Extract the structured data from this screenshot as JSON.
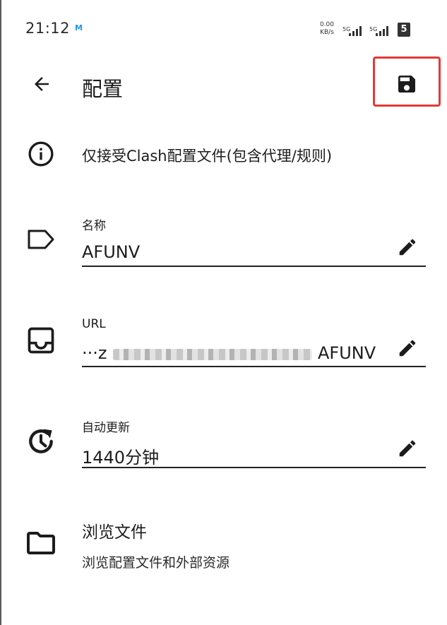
{
  "status_bar": {
    "time": "21:12",
    "carrier_logo": "M",
    "net_speed_value": "0.00",
    "net_speed_unit": "KB/s",
    "signal1_label": "5G",
    "signal2_label": "5G",
    "battery": "5"
  },
  "header": {
    "title": "配置",
    "back_icon": "arrow-left-icon",
    "save_icon": "floppy-save-icon"
  },
  "info": {
    "icon": "info-icon",
    "text": "仅接受Clash配置文件(包含代理/规则)"
  },
  "fields": {
    "name": {
      "label": "名称",
      "value": "AFUNV",
      "icon": "tag-icon"
    },
    "url": {
      "label": "URL",
      "value_prefix": "···z",
      "value_suffix": "AFUNV",
      "icon": "inbox-icon"
    },
    "auto_update": {
      "label": "自动更新",
      "value": "1440分钟",
      "icon": "timer-refresh-icon"
    }
  },
  "browse": {
    "icon": "folder-icon",
    "title": "浏览文件",
    "subtitle": "浏览配置文件和外部资源"
  },
  "colors": {
    "highlight_border": "#e53935",
    "text": "#1c1c1c",
    "carrier_logo": "#2196f3"
  }
}
